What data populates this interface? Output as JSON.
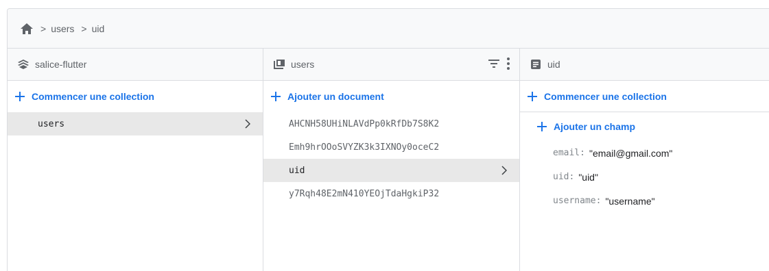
{
  "breadcrumb": {
    "icon": "home-icon",
    "items": [
      "users",
      "uid"
    ]
  },
  "panels": {
    "project": {
      "icon": "firestore-icon",
      "title": "salice-flutter",
      "add_label": "Commencer une collection",
      "items": [
        "users"
      ]
    },
    "collection": {
      "icon": "collection-icon",
      "title": "users",
      "add_label": "Ajouter un document",
      "items": [
        "AHCNH58UHiNLAVdPp0kRfDb7S8K2",
        "Emh9hrOOoSVYZK3k3IXNOy0oceC2",
        "uid",
        "y7Rqh48E2mN410YEOjTdaHgkiP32"
      ]
    },
    "document": {
      "icon": "document-icon",
      "title": "uid",
      "add_collection_label": "Commencer une collection",
      "add_field_label": "Ajouter un champ",
      "fields": [
        {
          "key": "email",
          "value": "\"email@gmail.com\""
        },
        {
          "key": "uid",
          "value": "\"uid\""
        },
        {
          "key": "username",
          "value": "\"username\""
        }
      ]
    }
  },
  "colors": {
    "accent": "#1a73e8",
    "selected": "#e8e8e8",
    "border": "#dadce0",
    "header_bg": "#f8f9fa"
  }
}
